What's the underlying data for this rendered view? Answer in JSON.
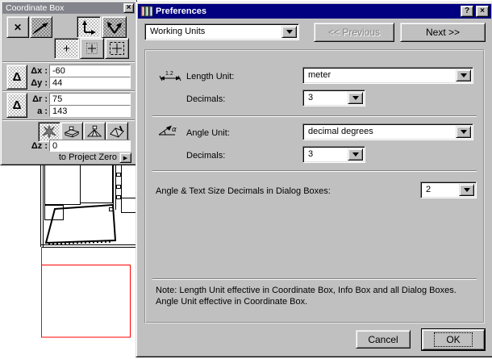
{
  "colors": {
    "window_bg": "#c0c0c0",
    "active_title_bg": "#000080",
    "inactive_title_bg": "#84848c",
    "title_text": "#ffffff",
    "plan_line": "#000000",
    "plan_marquee_red": "#ff0000"
  },
  "icons": {
    "close": "×",
    "help": "?",
    "cross": "✕",
    "plus": "+",
    "delta": "Δ",
    "arrow_right": "▶"
  },
  "coordinate_box": {
    "title": "Coordinate Box",
    "dx_label": "Δx :",
    "dx_value": "-60",
    "dy_label": "Δy :",
    "dy_value": "44",
    "dr_label": "Δr :",
    "dr_value": "75",
    "a_label": "a :",
    "a_value": "143",
    "dz_label": "Δz :",
    "dz_value": "0",
    "project_zero_label": "to Project Zero"
  },
  "preferences": {
    "title": "Preferences",
    "section_value": "Working Units",
    "previous_label": "<< Previous",
    "next_label": "Next >>",
    "length_unit_label": "Length Unit:",
    "length_unit_value": "meter",
    "length_decimals_label": "Decimals:",
    "length_decimals_value": "3",
    "angle_unit_label": "Angle Unit:",
    "angle_unit_value": "decimal degrees",
    "angle_decimals_label": "Decimals:",
    "angle_decimals_value": "3",
    "dialog_decimals_label": "Angle & Text Size Decimals in Dialog Boxes:",
    "dialog_decimals_value": "2",
    "note": "Note: Length Unit effective in Coordinate Box, Info Box and all Dialog Boxes. Angle Unit effective in Coordinate Box.",
    "cancel_label": "Cancel",
    "ok_label": "OK"
  }
}
